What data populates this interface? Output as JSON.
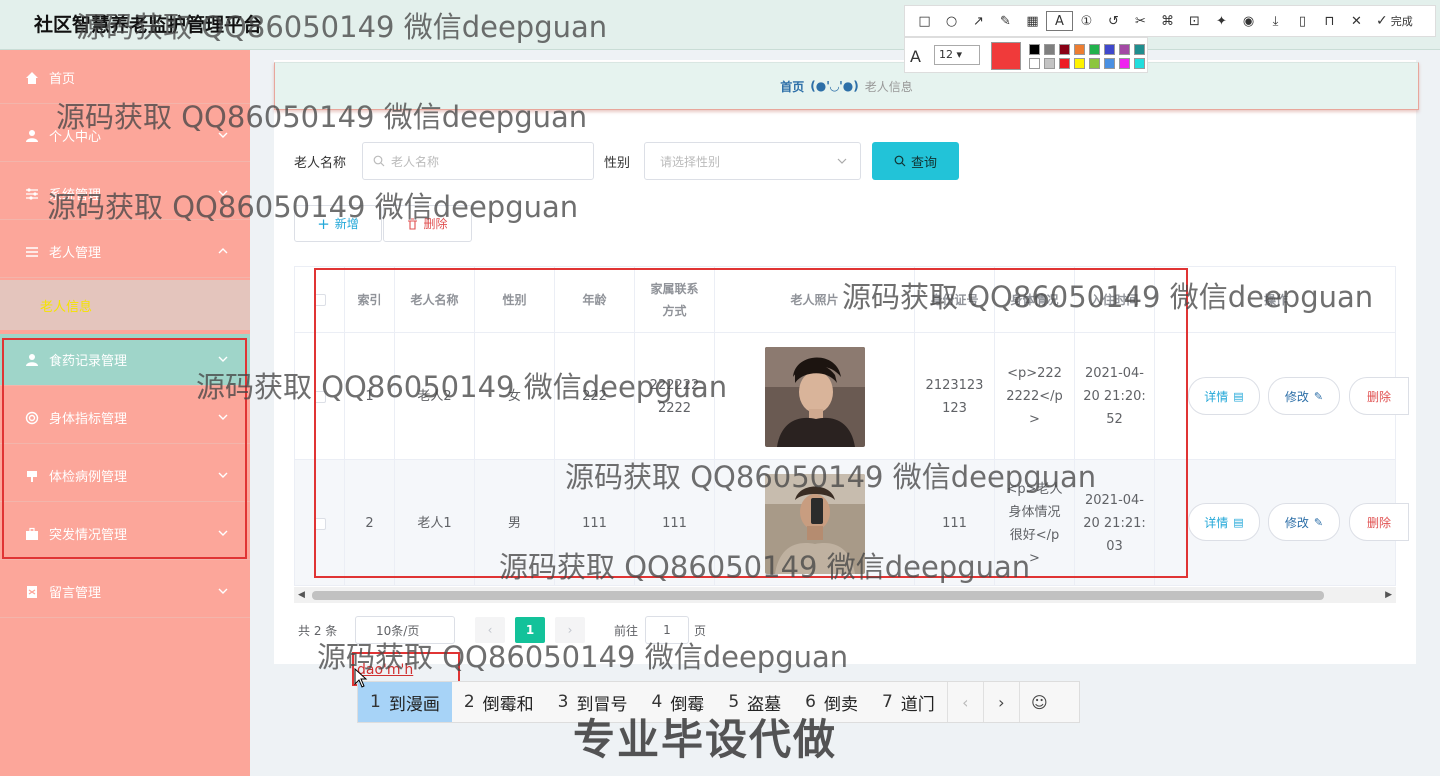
{
  "app": {
    "title": "社区智慧养老监护管理平台"
  },
  "sidebar": {
    "items": [
      {
        "label": "首页",
        "icon": "home-icon"
      },
      {
        "label": "个人中心",
        "icon": "user-icon"
      },
      {
        "label": "系统管理",
        "icon": "sliders-icon"
      },
      {
        "label": "老人管理",
        "icon": "list-icon"
      },
      {
        "label": "老人信息",
        "icon": ""
      },
      {
        "label": "食药记录管理",
        "icon": "user-icon"
      },
      {
        "label": "身体指标管理",
        "icon": "target-icon"
      },
      {
        "label": "体检病例管理",
        "icon": "clipboard-icon"
      },
      {
        "label": "突发情况管理",
        "icon": "briefcase-icon"
      },
      {
        "label": "留言管理",
        "icon": "note-icon"
      }
    ]
  },
  "breadcrumb": {
    "home": "首页",
    "face": "(●'◡'●)",
    "current": "老人信息"
  },
  "search": {
    "name_label": "老人名称",
    "name_placeholder": "老人名称",
    "gender_label": "性别",
    "gender_placeholder": "请选择性别",
    "query_label": "查询"
  },
  "actions": {
    "add": "新增",
    "delete": "删除"
  },
  "table": {
    "columns": [
      "索引",
      "老人名称",
      "性别",
      "年龄",
      "家属联系方式",
      "老人照片",
      "身份证号",
      "身体情况",
      "入住时间",
      "操作"
    ],
    "rows": [
      {
        "index": "1",
        "name": "老人2",
        "gender": "女",
        "age": "222",
        "contact": "2222222222",
        "id_no": "2123123123",
        "health": "<p>2222222</p>",
        "checkin": "2021-04-20 21:20:52"
      },
      {
        "index": "2",
        "name": "老人1",
        "gender": "男",
        "age": "111",
        "contact": "111",
        "id_no": "111",
        "health": "<p>老人身体情况很好</p>",
        "checkin": "2021-04-20 21:21:03"
      }
    ],
    "op_detail": "详情",
    "op_edit": "修改",
    "op_delete": "删除"
  },
  "pagination": {
    "total": "共 2 条",
    "page_size": "10条/页",
    "current": "1",
    "goto_label": "前往",
    "goto_value": "1",
    "page_suffix": "页"
  },
  "screenshot_tool": {
    "font_size": "12",
    "done": "完成",
    "current_color": "#f03a3a"
  },
  "ime": {
    "input": "dao'm'h",
    "candidates": [
      {
        "n": "1",
        "text": "到漫画"
      },
      {
        "n": "2",
        "text": "倒霉和"
      },
      {
        "n": "3",
        "text": "到冒号"
      },
      {
        "n": "4",
        "text": "倒霉"
      },
      {
        "n": "5",
        "text": "盗墓"
      },
      {
        "n": "6",
        "text": "倒卖"
      },
      {
        "n": "7",
        "text": "道门"
      }
    ]
  },
  "watermark": {
    "text": "源码获取 QQ86050149 微信deepguan",
    "banner": "专业毕设代做"
  }
}
